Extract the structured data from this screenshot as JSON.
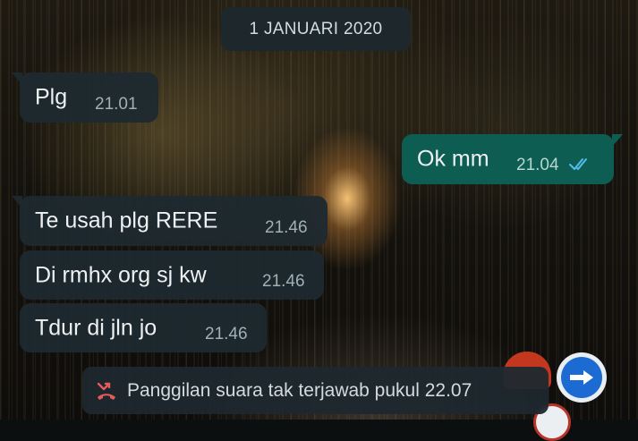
{
  "chat": {
    "date_chip": "1 JANUARI 2020",
    "messages": [
      {
        "direction": "in",
        "text": "Plg",
        "time": "21.01"
      },
      {
        "direction": "out",
        "text": "Ok mm",
        "time": "21.04",
        "status": "read",
        "status_icon": "double-check-icon"
      },
      {
        "direction": "in",
        "text": "Te usah plg RERE",
        "time": "21.46"
      },
      {
        "direction": "in",
        "text": "Di rmhx org sj kw",
        "time": "21.46"
      },
      {
        "direction": "in",
        "text": "Tdur di jln jo",
        "time": "21.46"
      }
    ],
    "missed_call": {
      "icon": "missed-call-icon",
      "text": "Panggilan suara tak terjawab pukul 22.07"
    }
  },
  "colors": {
    "incoming_bubble": "#1e2a30",
    "outgoing_bubble": "#0d5d53",
    "read_ticks": "#53bdeb",
    "missed_call_icon": "#e75a5a"
  }
}
